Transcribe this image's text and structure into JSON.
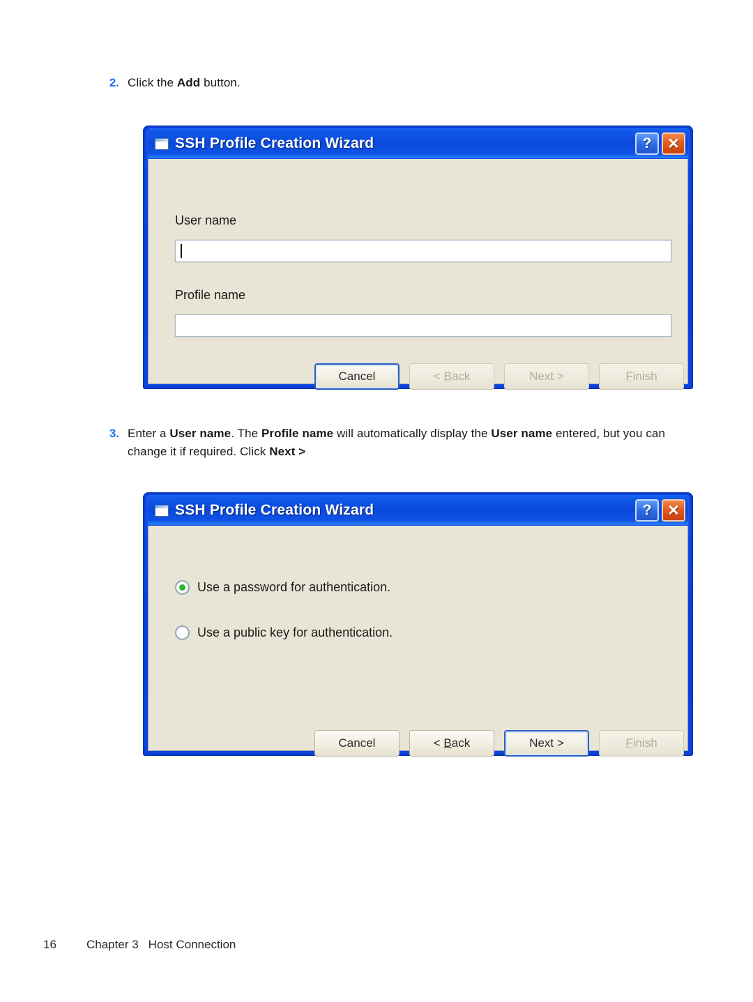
{
  "page": {
    "number": "16",
    "chapter": "Chapter 3",
    "section": "Host Connection"
  },
  "steps": [
    {
      "number": "2.",
      "segments": [
        {
          "text": "Click the ",
          "bold": false
        },
        {
          "text": "Add",
          "bold": true
        },
        {
          "text": " button.",
          "bold": false
        }
      ]
    },
    {
      "number": "3.",
      "segments": [
        {
          "text": "Enter a ",
          "bold": false
        },
        {
          "text": "User name",
          "bold": true
        },
        {
          "text": ". The ",
          "bold": false
        },
        {
          "text": "Profile name",
          "bold": true
        },
        {
          "text": " will automatically display the ",
          "bold": false
        },
        {
          "text": "User name",
          "bold": true
        },
        {
          "text": " entered, but you can change it if required. Click ",
          "bold": false
        },
        {
          "text": "Next >",
          "bold": true
        }
      ]
    }
  ],
  "dialogs": [
    {
      "title": "SSH Profile Creation Wizard",
      "window_icon": "window-icon",
      "help_icon": "?",
      "close_icon": "✕",
      "fields": [
        {
          "label": "User name",
          "value": "",
          "focused": true
        },
        {
          "label": "Profile name",
          "value": "",
          "focused": false
        }
      ],
      "buttons": [
        {
          "label": "Cancel",
          "accel": "",
          "state": "focused"
        },
        {
          "label": "< Back",
          "accel": "B",
          "state": "disabled"
        },
        {
          "label": "Next >",
          "accel": "",
          "state": "disabled"
        },
        {
          "label": "Finish",
          "accel": "F",
          "state": "disabled"
        }
      ]
    },
    {
      "title": "SSH Profile Creation Wizard",
      "window_icon": "window-icon",
      "help_icon": "?",
      "close_icon": "✕",
      "options": [
        {
          "label": "Use a password for authentication.",
          "selected": true
        },
        {
          "label": "Use a public key for authentication.",
          "selected": false
        }
      ],
      "buttons": [
        {
          "label": "Cancel",
          "accel": "",
          "state": "normal"
        },
        {
          "label": "< Back",
          "accel": "B",
          "state": "normal"
        },
        {
          "label": "Next >",
          "accel": "",
          "state": "focused"
        },
        {
          "label": "Finish",
          "accel": "F",
          "state": "disabled"
        }
      ]
    }
  ],
  "colors": {
    "accent": "#1a6ef0",
    "titlebar": "#0b49dd",
    "dialog_bg": "#e9e5d6",
    "close_button": "#e05a1f",
    "radio_dot": "#2fb52f"
  }
}
